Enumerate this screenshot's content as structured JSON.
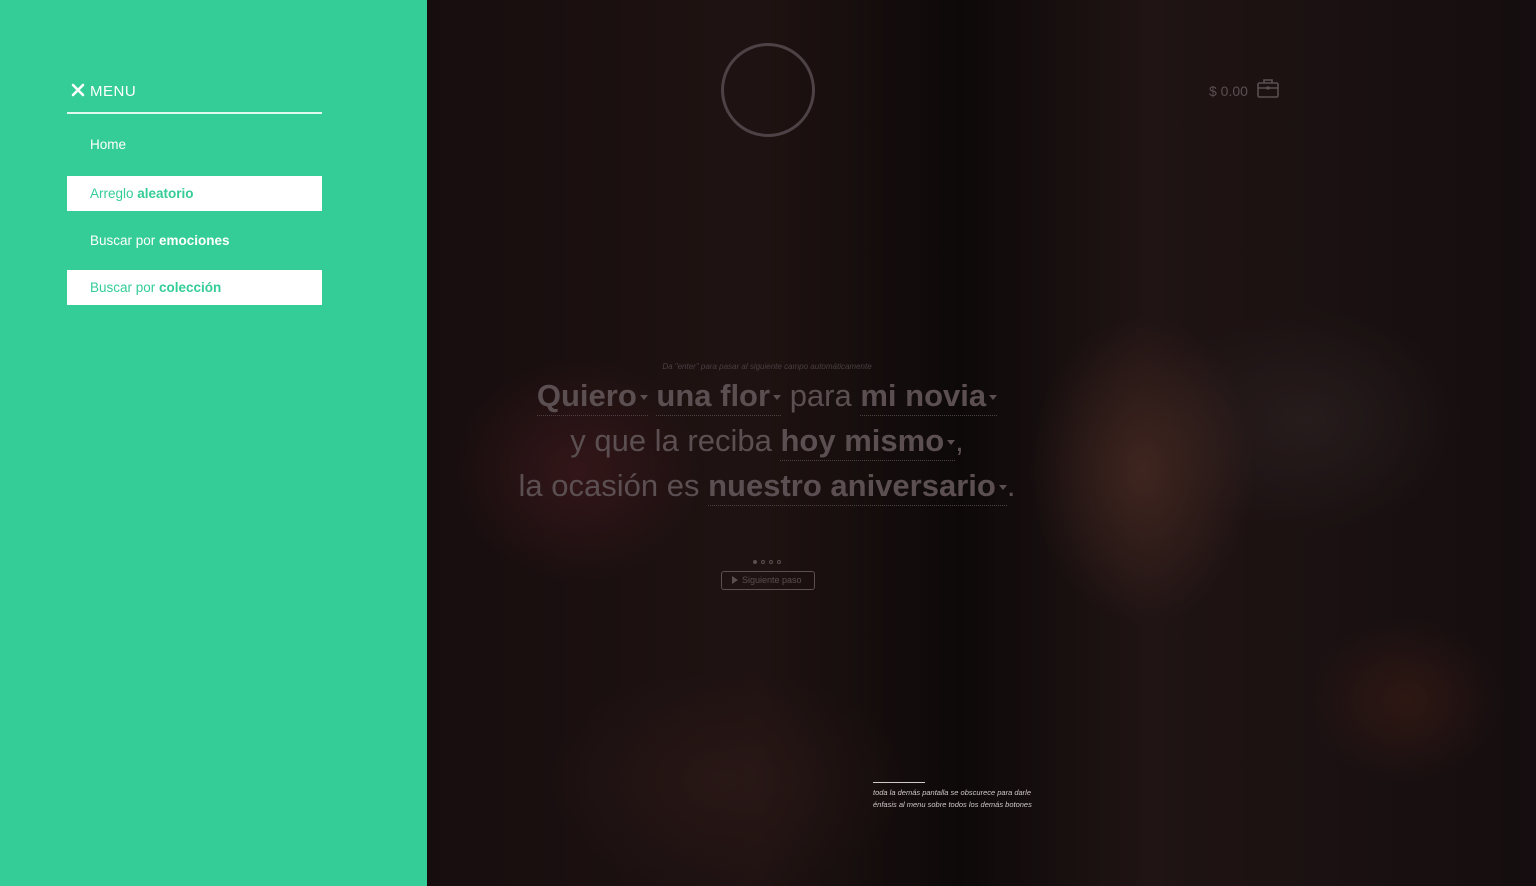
{
  "menu": {
    "title": "MENU",
    "items": [
      {
        "label": "Home",
        "emphasis": "",
        "boxed": false
      },
      {
        "label": "Arreglo ",
        "emphasis": "aleatorio",
        "boxed": true
      },
      {
        "label": "Buscar por ",
        "emphasis": "emociones",
        "boxed": false
      },
      {
        "label": "Buscar por ",
        "emphasis": "colección",
        "boxed": true
      }
    ]
  },
  "cart": {
    "total": "$ 0.00"
  },
  "form": {
    "hint": "Da \"enter\" para pasar al siguiente campo automáticamente",
    "line1": {
      "select1": "Quiero",
      "select2": "una flor",
      "text1": "para",
      "select3": "mi novia"
    },
    "line2": {
      "text1": "y que la reciba",
      "select1": "hoy mismo",
      "text2": ","
    },
    "line3": {
      "text1": "la ocasión es",
      "select1": "nuestro aniversario",
      "text2": "."
    },
    "steps": {
      "total": 4,
      "current": 1
    },
    "next_label": "Siguiente paso"
  },
  "annotation": {
    "text": "toda la demás pantalla se obscurece para darle énfasis al menu sobre todos los demás botones"
  },
  "colors": {
    "menu_bg": "#34cd97",
    "menu_text": "#ffffff",
    "overlay_text": "#5b4f52"
  }
}
